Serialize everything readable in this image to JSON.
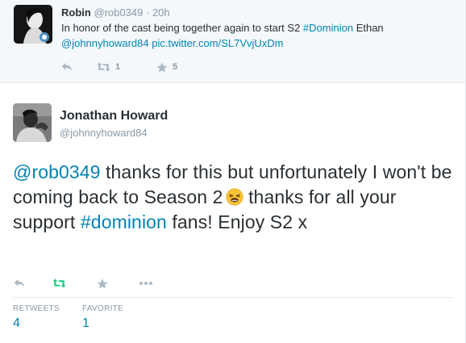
{
  "parent_tweet": {
    "name": "Robin",
    "handle": "@rob0349",
    "separator": "·",
    "time": "20h",
    "text_plain": "In honor of the cast being together again to start S2 ",
    "hashtag": "#Dominion",
    "text_after_hashtag": " Ethan",
    "mention": "@johnnyhoward84",
    "pic_link": "pic.twitter.com/SL7VvjUxDm",
    "retweet_count": "1",
    "favorite_count": "5"
  },
  "tweet": {
    "name": "Jonathan Howard",
    "handle": "@johnnyhoward84",
    "mention": "@rob0349",
    "text_part1": " thanks for this but unfortunately I won't be coming back to Season 2",
    "text_part2": " thanks for all your support ",
    "hashtag": "#dominion",
    "text_part3": " fans! Enjoy S2 x"
  },
  "stats": {
    "retweets_label": "RETWEETS",
    "retweets_value": "4",
    "favorites_label": "FAVORITE",
    "favorites_value": "1"
  },
  "icons": {
    "reply": "reply-icon",
    "retweet": "retweet-icon",
    "favorite": "star-icon",
    "more": "more-icon",
    "emoji": "weary-face-emoji"
  },
  "colors": {
    "link": "#0084b4",
    "retweet_active": "#19cf86",
    "muted": "#8899a6",
    "icon": "#aab8c2"
  }
}
